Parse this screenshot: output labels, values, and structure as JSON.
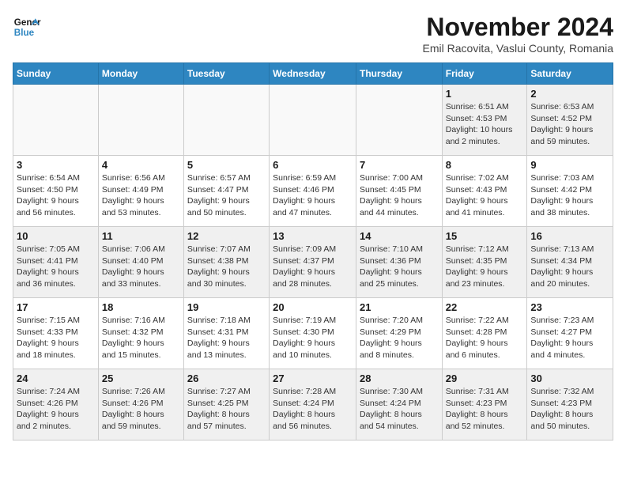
{
  "logo": {
    "line1": "General",
    "line2": "Blue"
  },
  "title": "November 2024",
  "subtitle": "Emil Racovita, Vaslui County, Romania",
  "days_of_week": [
    "Sunday",
    "Monday",
    "Tuesday",
    "Wednesday",
    "Thursday",
    "Friday",
    "Saturday"
  ],
  "weeks": [
    [
      {
        "day": "",
        "info": ""
      },
      {
        "day": "",
        "info": ""
      },
      {
        "day": "",
        "info": ""
      },
      {
        "day": "",
        "info": ""
      },
      {
        "day": "",
        "info": ""
      },
      {
        "day": "1",
        "info": "Sunrise: 6:51 AM\nSunset: 4:53 PM\nDaylight: 10 hours\nand 2 minutes."
      },
      {
        "day": "2",
        "info": "Sunrise: 6:53 AM\nSunset: 4:52 PM\nDaylight: 9 hours\nand 59 minutes."
      }
    ],
    [
      {
        "day": "3",
        "info": "Sunrise: 6:54 AM\nSunset: 4:50 PM\nDaylight: 9 hours\nand 56 minutes."
      },
      {
        "day": "4",
        "info": "Sunrise: 6:56 AM\nSunset: 4:49 PM\nDaylight: 9 hours\nand 53 minutes."
      },
      {
        "day": "5",
        "info": "Sunrise: 6:57 AM\nSunset: 4:47 PM\nDaylight: 9 hours\nand 50 minutes."
      },
      {
        "day": "6",
        "info": "Sunrise: 6:59 AM\nSunset: 4:46 PM\nDaylight: 9 hours\nand 47 minutes."
      },
      {
        "day": "7",
        "info": "Sunrise: 7:00 AM\nSunset: 4:45 PM\nDaylight: 9 hours\nand 44 minutes."
      },
      {
        "day": "8",
        "info": "Sunrise: 7:02 AM\nSunset: 4:43 PM\nDaylight: 9 hours\nand 41 minutes."
      },
      {
        "day": "9",
        "info": "Sunrise: 7:03 AM\nSunset: 4:42 PM\nDaylight: 9 hours\nand 38 minutes."
      }
    ],
    [
      {
        "day": "10",
        "info": "Sunrise: 7:05 AM\nSunset: 4:41 PM\nDaylight: 9 hours\nand 36 minutes."
      },
      {
        "day": "11",
        "info": "Sunrise: 7:06 AM\nSunset: 4:40 PM\nDaylight: 9 hours\nand 33 minutes."
      },
      {
        "day": "12",
        "info": "Sunrise: 7:07 AM\nSunset: 4:38 PM\nDaylight: 9 hours\nand 30 minutes."
      },
      {
        "day": "13",
        "info": "Sunrise: 7:09 AM\nSunset: 4:37 PM\nDaylight: 9 hours\nand 28 minutes."
      },
      {
        "day": "14",
        "info": "Sunrise: 7:10 AM\nSunset: 4:36 PM\nDaylight: 9 hours\nand 25 minutes."
      },
      {
        "day": "15",
        "info": "Sunrise: 7:12 AM\nSunset: 4:35 PM\nDaylight: 9 hours\nand 23 minutes."
      },
      {
        "day": "16",
        "info": "Sunrise: 7:13 AM\nSunset: 4:34 PM\nDaylight: 9 hours\nand 20 minutes."
      }
    ],
    [
      {
        "day": "17",
        "info": "Sunrise: 7:15 AM\nSunset: 4:33 PM\nDaylight: 9 hours\nand 18 minutes."
      },
      {
        "day": "18",
        "info": "Sunrise: 7:16 AM\nSunset: 4:32 PM\nDaylight: 9 hours\nand 15 minutes."
      },
      {
        "day": "19",
        "info": "Sunrise: 7:18 AM\nSunset: 4:31 PM\nDaylight: 9 hours\nand 13 minutes."
      },
      {
        "day": "20",
        "info": "Sunrise: 7:19 AM\nSunset: 4:30 PM\nDaylight: 9 hours\nand 10 minutes."
      },
      {
        "day": "21",
        "info": "Sunrise: 7:20 AM\nSunset: 4:29 PM\nDaylight: 9 hours\nand 8 minutes."
      },
      {
        "day": "22",
        "info": "Sunrise: 7:22 AM\nSunset: 4:28 PM\nDaylight: 9 hours\nand 6 minutes."
      },
      {
        "day": "23",
        "info": "Sunrise: 7:23 AM\nSunset: 4:27 PM\nDaylight: 9 hours\nand 4 minutes."
      }
    ],
    [
      {
        "day": "24",
        "info": "Sunrise: 7:24 AM\nSunset: 4:26 PM\nDaylight: 9 hours\nand 2 minutes."
      },
      {
        "day": "25",
        "info": "Sunrise: 7:26 AM\nSunset: 4:26 PM\nDaylight: 8 hours\nand 59 minutes."
      },
      {
        "day": "26",
        "info": "Sunrise: 7:27 AM\nSunset: 4:25 PM\nDaylight: 8 hours\nand 57 minutes."
      },
      {
        "day": "27",
        "info": "Sunrise: 7:28 AM\nSunset: 4:24 PM\nDaylight: 8 hours\nand 56 minutes."
      },
      {
        "day": "28",
        "info": "Sunrise: 7:30 AM\nSunset: 4:24 PM\nDaylight: 8 hours\nand 54 minutes."
      },
      {
        "day": "29",
        "info": "Sunrise: 7:31 AM\nSunset: 4:23 PM\nDaylight: 8 hours\nand 52 minutes."
      },
      {
        "day": "30",
        "info": "Sunrise: 7:32 AM\nSunset: 4:23 PM\nDaylight: 8 hours\nand 50 minutes."
      }
    ]
  ]
}
